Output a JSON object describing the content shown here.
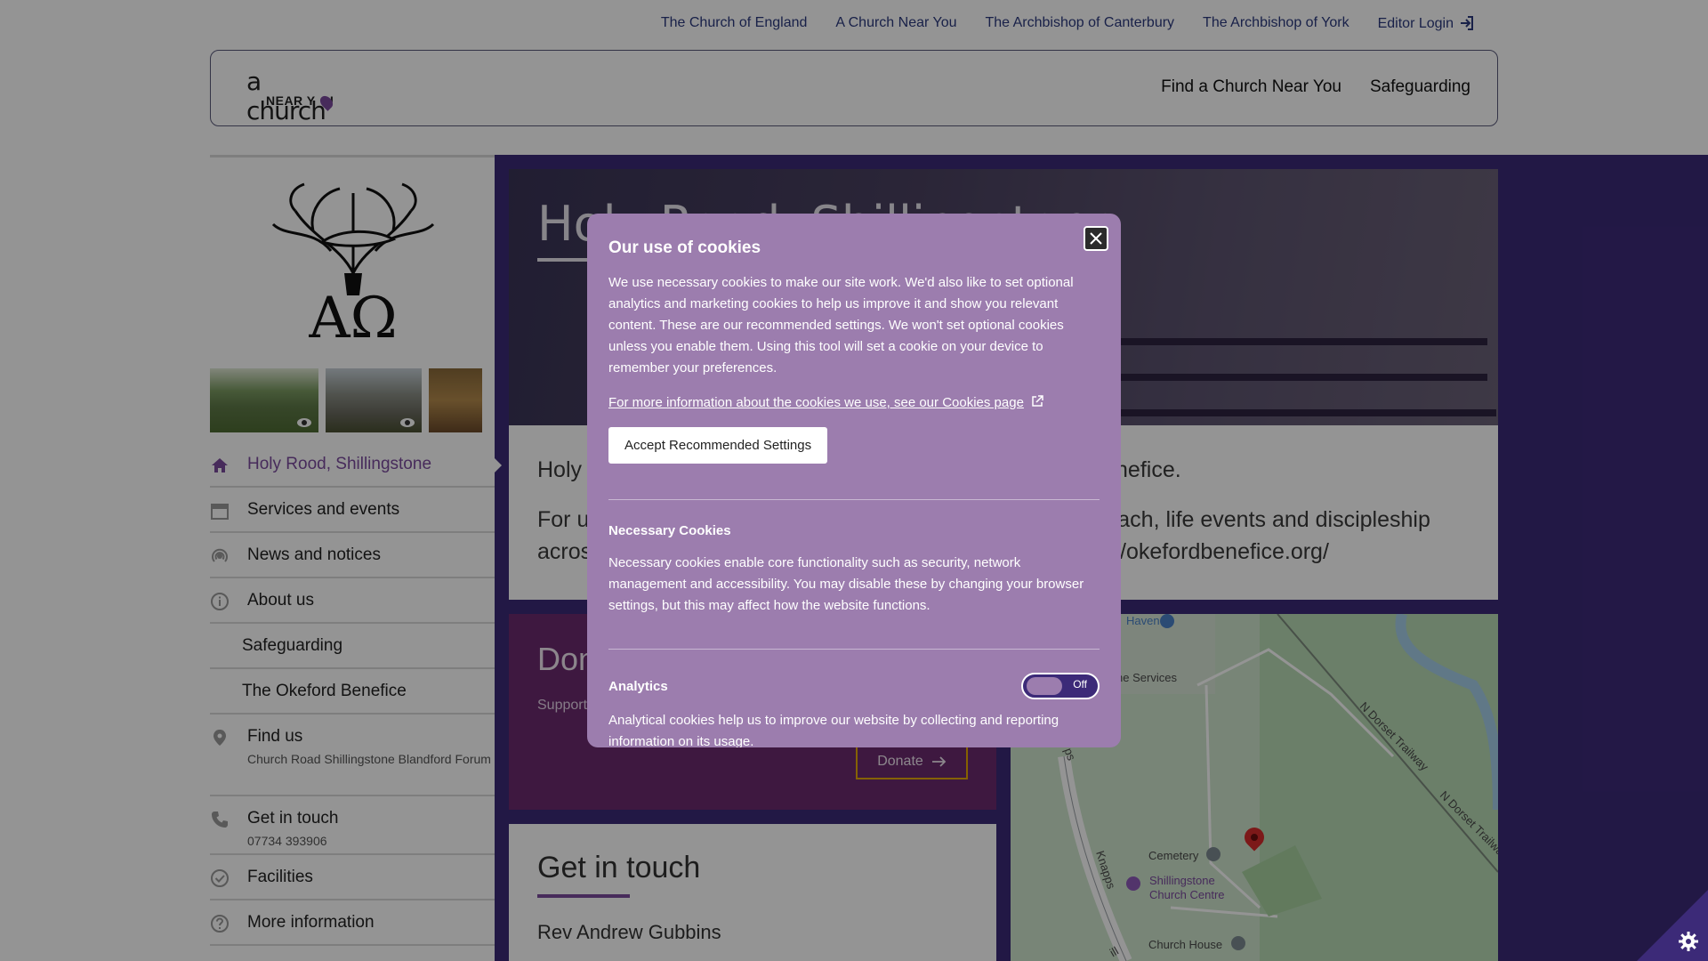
{
  "top_links": {
    "church_of_england": "The Church of England",
    "church_near_you": "A Church Near You",
    "archbishop_canterbury": "The Archbishop of Canterbury",
    "archbishop_york": "The Archbishop of York",
    "editor_login": "Editor Login"
  },
  "logo": {
    "line1": "a church",
    "line2": "NEAR Y",
    "line2b": "U"
  },
  "main_nav": {
    "find": "Find a Church Near You",
    "safeguarding": "Safeguarding"
  },
  "sidebar": {
    "crest_text": "ΑΩ",
    "items": [
      {
        "label": "Holy Rood, Shillingstone",
        "icon": "home-icon"
      },
      {
        "label": "Services and events",
        "icon": "calendar-icon"
      },
      {
        "label": "News and notices",
        "icon": "broadcast-icon"
      },
      {
        "label": "About us",
        "icon": "info-icon"
      },
      {
        "label": "Safeguarding"
      },
      {
        "label": "The Okeford Benefice"
      },
      {
        "label": "Find us",
        "sub": "Church Road Shillingstone Blandford Forum",
        "icon": "map-pin-icon"
      },
      {
        "label": "Get in touch",
        "sub": "07734 393906",
        "icon": "phone-icon"
      },
      {
        "label": "Facilities",
        "icon": "check-circle-icon"
      },
      {
        "label": "More information",
        "icon": "question-icon"
      }
    ]
  },
  "hero": {
    "title": "Holy Rood, Shillingstone"
  },
  "intro": {
    "p1_left": "Holy",
    "p1_right": "nefice.",
    "p2_left_a": "For u",
    "p2_left_b": "acros",
    "p2_right_a": "each, life events and discipleship",
    "p2_right_b": "://okefordbenefice.org/"
  },
  "donate": {
    "title": "Donate",
    "sub": "Support",
    "button": "Donate"
  },
  "get_in_touch": {
    "title": "Get in touch",
    "person": "Rev Andrew Gubbins"
  },
  "map": {
    "labels": {
      "haven": "Haven",
      "crane": "c Crane Services",
      "ps": "ps",
      "trailway1": "N Dorset Trailway",
      "trailway2": "N Dorset Trailway",
      "cemetery": "Cemetery",
      "centre1": "Shillingstone",
      "centre2": "Church Centre",
      "knapps": "Knapps",
      "house": "Church House",
      "ill": "ill"
    }
  },
  "cookie": {
    "title": "Our use of cookies",
    "body": "We use necessary cookies to make our site work. We'd also like to set optional analytics and marketing cookies to help us improve it and show you relevant content. These are our recommended settings. We won't set optional cookies unless you enable them. Using this tool will set a cookie on your device to remember your preferences.",
    "more_link": "For more information about the cookies we use, see our Cookies page",
    "accept": "Accept Recommended Settings",
    "necessary_title": "Necessary Cookies",
    "necessary_body": "Necessary cookies enable core functionality such as security, network management and accessibility. You may disable these by changing your browser settings, but this may affect how the website functions.",
    "analytics_title": "Analytics",
    "analytics_state": "Off",
    "analytics_body": "Analytical cookies help us to improve our website by collecting and reporting information on its usage."
  },
  "colors": {
    "purple": "#3c2a78",
    "plum": "#6b2a6e",
    "accent": "#7b4a9e",
    "modal": "#9c7dae",
    "gold": "#e6a800"
  }
}
